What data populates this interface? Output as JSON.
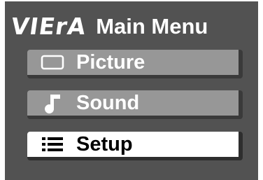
{
  "header": {
    "brand": "VIErA",
    "title": "Main Menu"
  },
  "menu": {
    "items": [
      {
        "label": "Picture",
        "icon": "picture-rectangle-icon",
        "selected": false
      },
      {
        "label": "Sound",
        "icon": "music-note-icon",
        "selected": false
      },
      {
        "label": "Setup",
        "icon": "list-icon",
        "selected": true
      }
    ]
  },
  "colors": {
    "panel_background": "#525252",
    "item_inactive": "#979797",
    "item_active": "#ffffff",
    "item_shadow": "#3a3a3a",
    "text_light": "#ffffff",
    "text_dark": "#000000"
  }
}
